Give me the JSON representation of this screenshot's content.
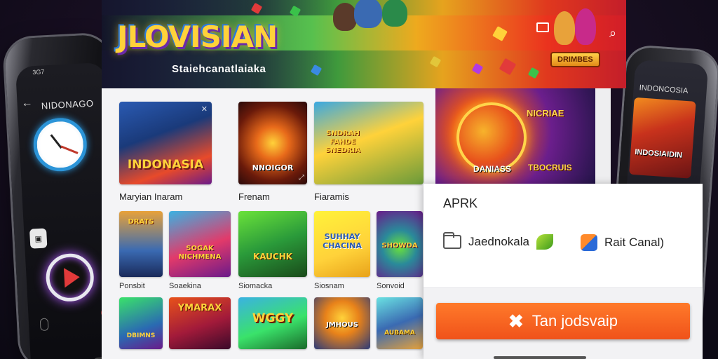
{
  "left_phone": {
    "status_text": "3G7",
    "title": "NIDONAGO",
    "back_glyph": "←"
  },
  "right_phone": {
    "title": "INDONCOSIA",
    "art_title": "INDOSIAIDIN"
  },
  "hero": {
    "logo": "JLOVISIAN",
    "subtitle": "Staiehcanatlaiaka",
    "badge": "DRIMBES",
    "search_glyph": "⌕"
  },
  "grid": {
    "row1": [
      {
        "art_title": "INDONASIA",
        "label": "Maryian Inaram"
      },
      {
        "art_title": "NNOIGOR",
        "label": "Frenam"
      },
      {
        "art_title": "SNDRAH FAHDE SNEDRIA",
        "label": "Fiaramis"
      }
    ],
    "row2": [
      {
        "art_title": "DRATS",
        "label": "Ponsbit"
      },
      {
        "art_title": "SOGAK NICHMENA",
        "label": "Soaekina"
      },
      {
        "art_title": "KAUCHK",
        "label": "Siomacka"
      },
      {
        "art_title": "SUHHAY CHACINA",
        "label": "Siosnam"
      },
      {
        "art_title": "SHOWDA",
        "label": "Sonvoid"
      }
    ],
    "row3": [
      {
        "art_title": "DBIMNS",
        "label": ""
      },
      {
        "art_title": "YMARAX",
        "label": ""
      },
      {
        "art_title": "WGGY",
        "label": ""
      },
      {
        "art_title": "JMHOUS",
        "label": ""
      },
      {
        "art_title": "AUBAMA",
        "label": ""
      }
    ]
  },
  "featured": {
    "title": "NICRIAE",
    "sub_left": "DANIASS",
    "sub_right": "TBOCRUIS"
  },
  "dialog": {
    "title": "APRK",
    "option_left": "Jaednokala",
    "option_right": "Rait Canal)",
    "install_label": "Tan jodsvaip",
    "install_glyph": "✖"
  },
  "colors": {
    "accent_orange": "#f0521a",
    "panel_bg": "#f4f4f6",
    "dialog_bg": "#ffffff"
  }
}
